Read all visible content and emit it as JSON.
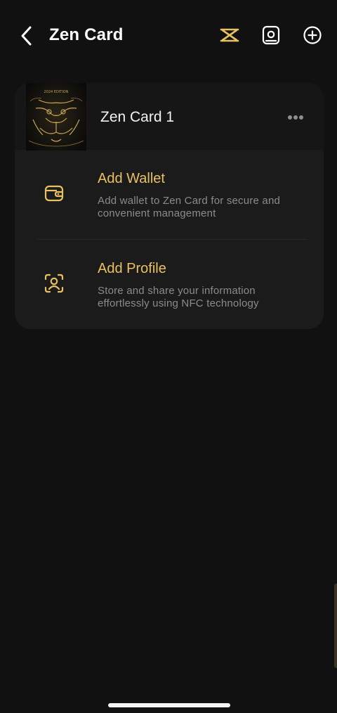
{
  "header": {
    "title": "Zen Card",
    "icons": [
      "back-chevron-icon",
      "zen-logo-icon",
      "profile-card-icon",
      "add-circle-icon"
    ]
  },
  "card": {
    "name": "Zen Card 1",
    "edition_label": "2024 EDITION",
    "more_icon": "more-dots-icon"
  },
  "options": [
    {
      "title": "Add Wallet",
      "description": "Add wallet to Zen Card for secure and convenient management",
      "icon": "wallet-icon"
    },
    {
      "title": "Add Profile",
      "description": "Store and share your information effortlessly using NFC technology",
      "icon": "profile-scan-icon"
    }
  ],
  "colors": {
    "background": "#111112",
    "panel": "#1b1b1c",
    "accent_gold": "#e9c25f",
    "text_secondary": "#8b8b8d"
  }
}
